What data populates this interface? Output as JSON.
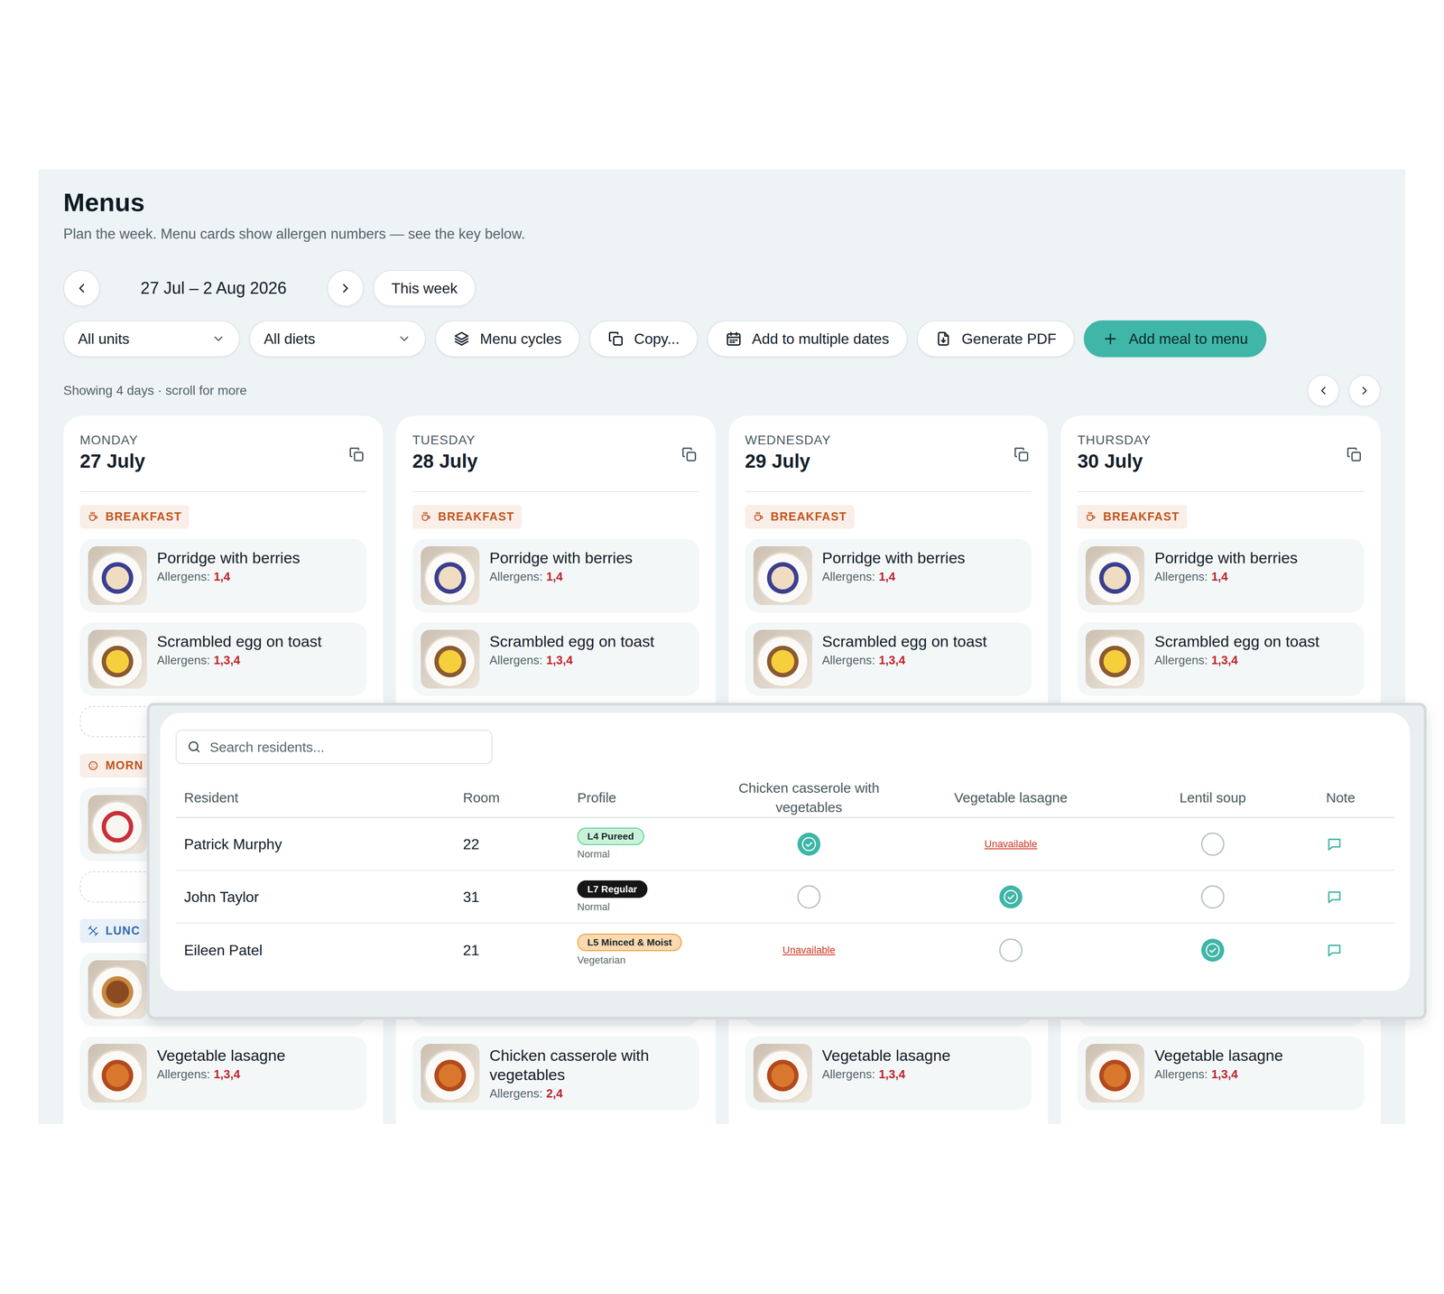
{
  "page": {
    "title": "Menus",
    "subtitle": "Plan the week. Menu cards show allergen numbers — see the key below."
  },
  "week": {
    "range": "27 Jul – 2 Aug 2026",
    "this_week": "This week"
  },
  "toolbar": {
    "filters": [
      "All units",
      "All diets"
    ],
    "actions": [
      "Menu cycles",
      "Copy...",
      "Add to multiple dates",
      "Generate PDF"
    ],
    "primary": "Add meal to menu"
  },
  "scroll_hint": "Showing 4 days · scroll for more",
  "days": [
    {
      "weekday": "MONDAY",
      "date": "27 July",
      "entries": [
        {
          "kind": "section",
          "label": "BREAKFAST",
          "color": "#c2551c"
        },
        {
          "kind": "dish",
          "name": "Porridge with berries",
          "allergens_label": "Allergens:",
          "allergens": "1,4"
        },
        {
          "kind": "dish",
          "name": "Scrambled egg on toast",
          "allergens_label": "Allergens:",
          "allergens": "1,3,4"
        },
        {
          "kind": "slot"
        },
        {
          "kind": "section",
          "label": "MORN",
          "color": "#c2551c"
        },
        {
          "kind": "covered-dish"
        },
        {
          "kind": "slot"
        },
        {
          "kind": "section",
          "label": "LUNC",
          "color": "#2c6db0"
        },
        {
          "kind": "covered-dish"
        },
        {
          "kind": "dish",
          "name": "Vegetable lasagne",
          "allergens_label": "Allergens:",
          "allergens": "1,3,4"
        }
      ]
    },
    {
      "weekday": "TUESDAY",
      "date": "28 July",
      "entries": [
        {
          "kind": "section",
          "label": "BREAKFAST",
          "color": "#c2551c"
        },
        {
          "kind": "dish",
          "name": "Porridge with berries",
          "allergens_label": "Allergens:",
          "allergens": "1,4"
        },
        {
          "kind": "dish",
          "name": "Scrambled egg on toast",
          "allergens_label": "Allergens:",
          "allergens": "1,3,4"
        },
        {
          "kind": "slot"
        },
        {
          "kind": "covered-section"
        },
        {
          "kind": "covered-dish"
        },
        {
          "kind": "slot"
        },
        {
          "kind": "covered-section"
        },
        {
          "kind": "covered-dish"
        },
        {
          "kind": "dish",
          "name": "Chicken casserole with vegetables",
          "allergens_label": "Allergens:",
          "allergens": "2,4"
        }
      ]
    },
    {
      "weekday": "WEDNESDAY",
      "date": "29 July",
      "entries": [
        {
          "kind": "section",
          "label": "BREAKFAST",
          "color": "#c2551c"
        },
        {
          "kind": "dish",
          "name": "Porridge with berries",
          "allergens_label": "Allergens:",
          "allergens": "1,4"
        },
        {
          "kind": "dish",
          "name": "Scrambled egg on toast",
          "allergens_label": "Allergens:",
          "allergens": "1,3,4"
        },
        {
          "kind": "slot"
        },
        {
          "kind": "covered-section"
        },
        {
          "kind": "covered-dish"
        },
        {
          "kind": "slot"
        },
        {
          "kind": "covered-section"
        },
        {
          "kind": "covered-dish"
        },
        {
          "kind": "dish",
          "name": "Vegetable lasagne",
          "allergens_label": "Allergens:",
          "allergens": "1,3,4"
        }
      ]
    },
    {
      "weekday": "THURSDAY",
      "date": "30 July",
      "entries": [
        {
          "kind": "section",
          "label": "BREAKFAST",
          "color": "#c2551c"
        },
        {
          "kind": "dish",
          "name": "Porridge with berries",
          "allergens_label": "Allergens:",
          "allergens": "1,4"
        },
        {
          "kind": "dish",
          "name": "Scrambled egg on toast",
          "allergens_label": "Allergens:",
          "allergens": "1,3,4"
        },
        {
          "kind": "slot"
        },
        {
          "kind": "covered-section"
        },
        {
          "kind": "covered-dish"
        },
        {
          "kind": "slot"
        },
        {
          "kind": "covered-section"
        },
        {
          "kind": "covered-dish"
        },
        {
          "kind": "dish",
          "name": "Vegetable lasagne",
          "allergens_label": "Allergens:",
          "allergens": "1,3,4"
        }
      ]
    }
  ],
  "picker": {
    "search": {
      "placeholder": "Search residents..."
    },
    "columns": [
      "Resident",
      "Room",
      "Profile",
      "Chicken casserole with vegetables",
      "Vegetable lasagne",
      "Lentil soup",
      "Note"
    ],
    "rows": [
      {
        "resident": "Patrick Murphy",
        "room": "22",
        "profile": {
          "label": "L4 Pureed",
          "color": "#c9f1da"
        },
        "diet": "Normal",
        "choices": [
          {
            "kind": "choice",
            "selected": true
          },
          {
            "kind": "unavailable",
            "text": "Unavailable"
          },
          {
            "kind": "choice",
            "selected": false
          }
        ]
      },
      {
        "resident": "John Taylor",
        "room": "31",
        "profile": {
          "label": "L7 Regular",
          "color": "#161616"
        },
        "diet": "Normal",
        "choices": [
          {
            "kind": "choice",
            "selected": false
          },
          {
            "kind": "choice",
            "selected": true
          },
          {
            "kind": "choice",
            "selected": false
          }
        ]
      },
      {
        "resident": "Eileen Patel",
        "room": "21",
        "profile": {
          "label": "L5 Minced & Moist",
          "color": "#fcd9b0"
        },
        "diet": "Vegetarian",
        "choices": [
          {
            "kind": "unavailable",
            "text": "Unavailable"
          },
          {
            "kind": "choice",
            "selected": false
          },
          {
            "kind": "choice",
            "selected": true
          }
        ]
      }
    ]
  }
}
